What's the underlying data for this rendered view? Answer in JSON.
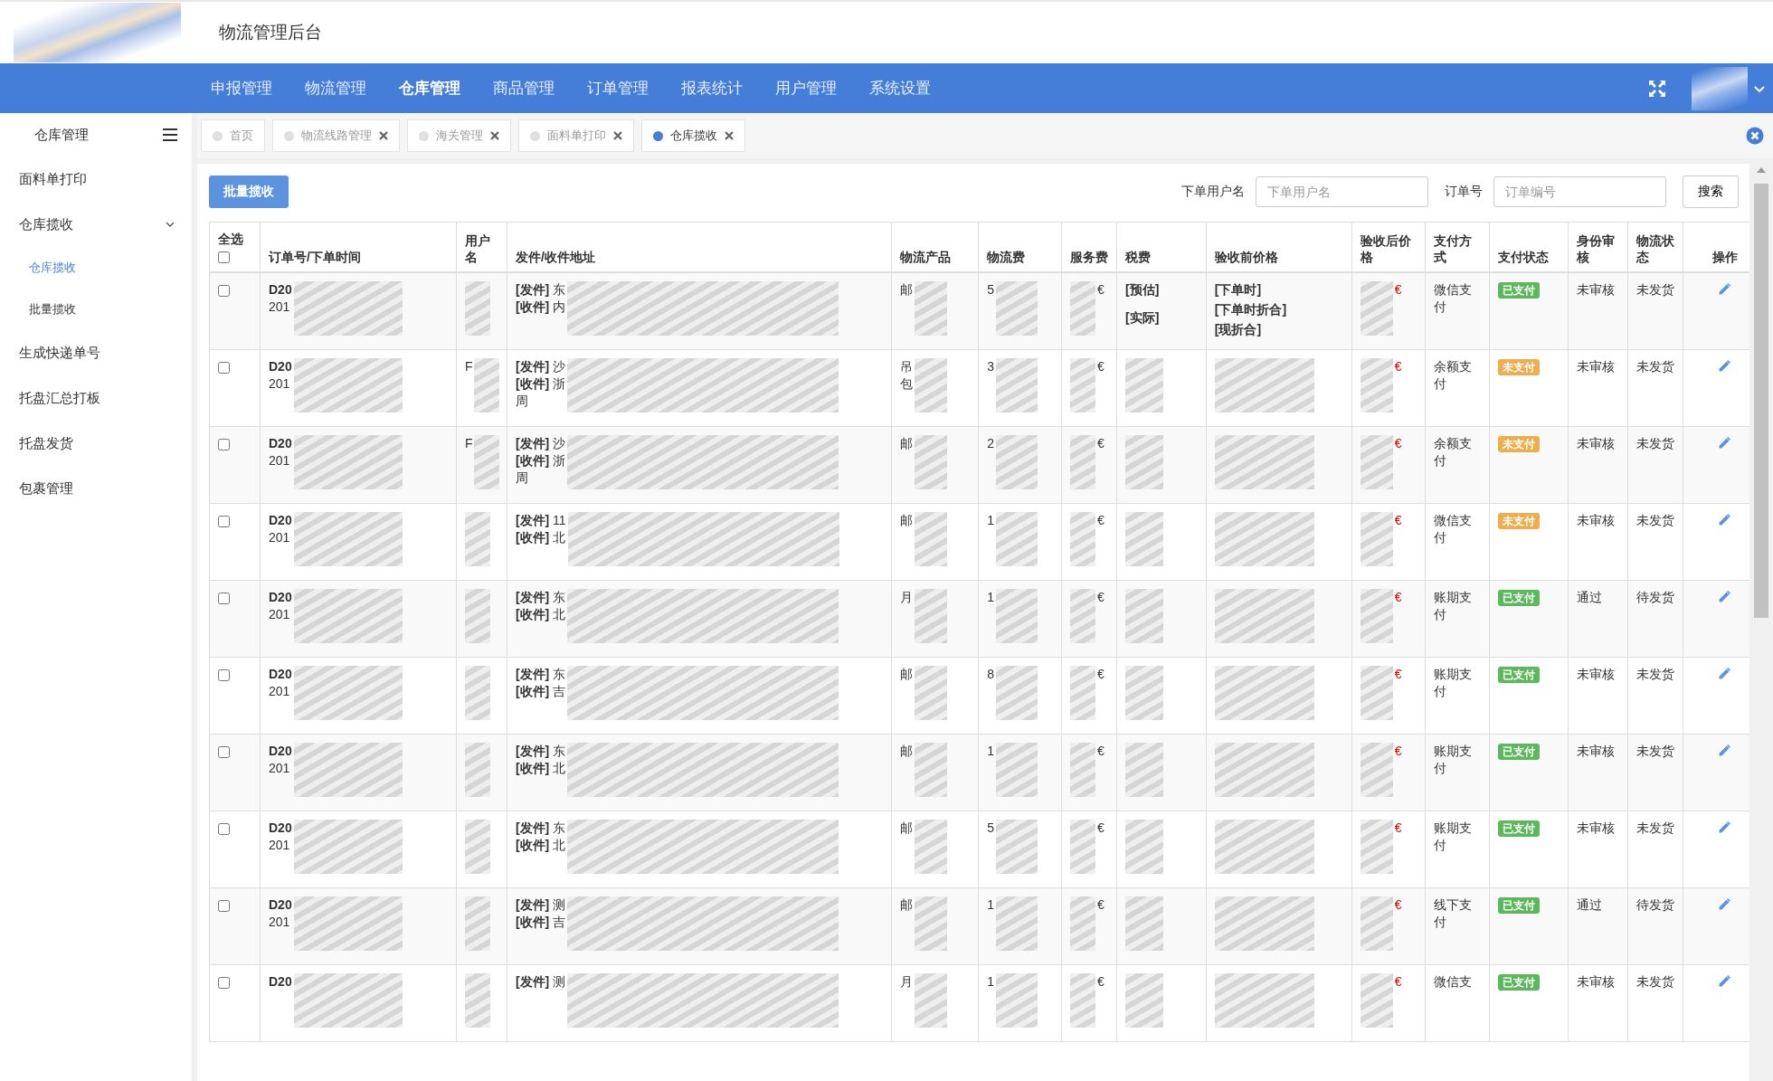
{
  "header": {
    "title": "物流管理后台"
  },
  "nav": [
    {
      "label": "申报管理",
      "selected": false
    },
    {
      "label": "物流管理",
      "selected": false
    },
    {
      "label": "仓库管理",
      "selected": true
    },
    {
      "label": "商品管理",
      "selected": false
    },
    {
      "label": "订单管理",
      "selected": false
    },
    {
      "label": "报表统计",
      "selected": false
    },
    {
      "label": "用户管理",
      "selected": false
    },
    {
      "label": "系统设置",
      "selected": false
    }
  ],
  "sidebar": {
    "title": "仓库管理",
    "items": [
      {
        "label": "面料单打印"
      },
      {
        "label": "仓库揽收",
        "expanded": true,
        "children": [
          {
            "label": "仓库揽收",
            "selected": true
          },
          {
            "label": "批量揽收",
            "selected": false
          }
        ]
      },
      {
        "label": "生成快递单号"
      },
      {
        "label": "托盘汇总打板"
      },
      {
        "label": "托盘发货"
      },
      {
        "label": "包裹管理"
      }
    ]
  },
  "tabs": [
    {
      "label": "首页",
      "selected": false,
      "closable": false
    },
    {
      "label": "物流线路管理",
      "selected": false,
      "closable": true
    },
    {
      "label": "海关管理",
      "selected": false,
      "closable": true
    },
    {
      "label": "面料单打印",
      "selected": false,
      "closable": true
    },
    {
      "label": "仓库揽收",
      "selected": true,
      "closable": true
    }
  ],
  "toolbar": {
    "batch_button": "批量揽收",
    "fields": [
      {
        "label": "下单用户名",
        "placeholder": "下单用户名"
      },
      {
        "label": "订单号",
        "placeholder": "订单编号"
      }
    ],
    "search_button": "搜索"
  },
  "table": {
    "select_all": {
      "label": "全选",
      "checked": false
    },
    "columns": [
      "订单号/下单时间",
      "用户名",
      "发件/收件地址",
      "物流产品",
      "物流费",
      "服务费",
      "税费",
      "验收前价格",
      "验收后价格",
      "支付方式",
      "支付状态",
      "身份审核",
      "物流状态",
      "操作"
    ],
    "rows": [
      {
        "checked": false,
        "order_no": "D20",
        "order_time": "201",
        "sender": "**[发件]** 东",
        "receiver": "**[收件]** 内",
        "product": [
          "邮"
        ],
        "fee": "5",
        "service": "€",
        "tax_lines": [
          "[预估]",
          "[实际]"
        ],
        "price_lines": [
          "[下单时]",
          "[下单时折合]",
          "[现折合]"
        ],
        "post_price": "€",
        "pay_method": "微信支付",
        "pay_status": {
          "label": "已支付",
          "kind": "paid"
        },
        "id_check": "未审核",
        "logistics": "未发货"
      },
      {
        "checked": false,
        "order_no": "D20",
        "order_time": "201",
        "user": "F",
        "sender": "**[发件]** 沙",
        "receiver": "**[收件]** 浙",
        "address_extra": "周",
        "product": [
          "吊",
          "包"
        ],
        "fee": "3",
        "service": "€",
        "post_price": "€",
        "pay_method": "余额支付",
        "pay_status": {
          "label": "未支付",
          "kind": "unpaid"
        },
        "id_check": "未审核",
        "logistics": "未发货"
      },
      {
        "checked": false,
        "order_no": "D20",
        "order_time": "201",
        "user": "F",
        "sender": "**[发件]** 沙",
        "receiver": "**[收件]** 浙",
        "address_extra": "周",
        "product": [
          "邮"
        ],
        "fee": "2",
        "service": "€",
        "post_price": "€",
        "pay_method": "余额支付",
        "pay_status": {
          "label": "未支付",
          "kind": "unpaid"
        },
        "id_check": "未审核",
        "logistics": "未发货"
      },
      {
        "checked": false,
        "order_no": "D20",
        "order_time": "201",
        "sender": "**[发件]** 11",
        "receiver": "**[收件]** 北",
        "product": [
          "邮"
        ],
        "fee": "1",
        "service": "€",
        "post_price": "€",
        "pay_method": "微信支付",
        "pay_status": {
          "label": "未支付",
          "kind": "unpaid"
        },
        "id_check": "未审核",
        "logistics": "未发货"
      },
      {
        "checked": false,
        "order_no": "D20",
        "order_time": "201",
        "sender": "**[发件]** 东",
        "receiver": "**[收件]** 北",
        "product": [
          "月"
        ],
        "fee": "1",
        "service": "€",
        "post_price": "€",
        "pay_method": "账期支付",
        "pay_status": {
          "label": "已支付",
          "kind": "paid"
        },
        "id_check": "通过",
        "logistics": "待发货"
      },
      {
        "checked": false,
        "order_no": "D20",
        "order_time": "201",
        "sender": "**[发件]** 东",
        "receiver": "**[收件]** 吉",
        "product": [
          "邮"
        ],
        "fee": "8",
        "service": "€",
        "post_price": "€",
        "pay_method": "账期支付",
        "pay_status": {
          "label": "已支付",
          "kind": "paid"
        },
        "id_check": "未审核",
        "logistics": "未发货"
      },
      {
        "checked": false,
        "order_no": "D20",
        "order_time": "201",
        "sender": "**[发件]** 东",
        "receiver": "**[收件]** 北",
        "product": [
          "邮"
        ],
        "fee": "1",
        "service": "€",
        "post_price": "€",
        "pay_method": "账期支付",
        "pay_status": {
          "label": "已支付",
          "kind": "paid"
        },
        "id_check": "未审核",
        "logistics": "未发货"
      },
      {
        "checked": false,
        "order_no": "D20",
        "order_time": "201",
        "sender": "**[发件]** 东",
        "receiver": "**[收件]** 北",
        "product": [
          "邮"
        ],
        "fee": "5",
        "service": "€",
        "post_price": "€",
        "pay_method": "账期支付",
        "pay_status": {
          "label": "已支付",
          "kind": "paid"
        },
        "id_check": "未审核",
        "logistics": "未发货"
      },
      {
        "checked": false,
        "order_no": "D20",
        "order_time": "201",
        "sender": "**[发件]** 测",
        "receiver": "**[收件]** 吉",
        "product": [
          "邮"
        ],
        "fee": "1",
        "service": "€",
        "post_price": "€",
        "pay_method": "线下支付",
        "pay_status": {
          "label": "已支付",
          "kind": "paid"
        },
        "id_check": "通过",
        "logistics": "待发货"
      },
      {
        "checked": false,
        "order_no": "D20",
        "sender": "**[发件]** 测",
        "product": [
          "月"
        ],
        "fee": "1",
        "service": "€",
        "post_price": "€",
        "pay_method": "微信支",
        "pay_status": {
          "label": "已支付",
          "kind": "paid"
        },
        "id_check": "未审核",
        "logistics": "未发货"
      }
    ]
  }
}
